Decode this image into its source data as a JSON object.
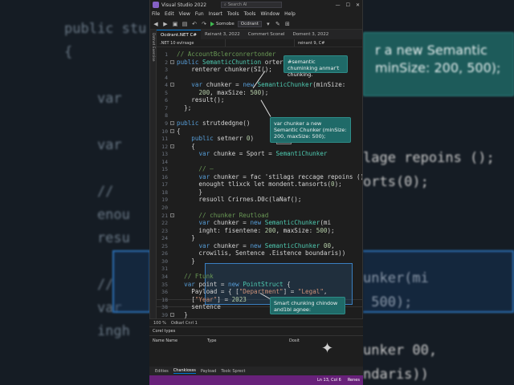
{
  "window": {
    "title": "Visual Studio 2022",
    "search_placeholder": "Search AI",
    "minimize": "—",
    "maximize": "☐",
    "close": "✕"
  },
  "menu": [
    "File",
    "Edit",
    "View",
    "Fun",
    "Insert",
    "Tools",
    "Tools",
    "Window",
    "Help"
  ],
  "toolbar": {
    "run_label": "Sornobe",
    "config": "Ocdrant"
  },
  "sidebar_label": "Dotnet Exercise",
  "tabs": [
    "Ocdrant.NET C#",
    "Reinant 3, 2022",
    "Commert Sconel",
    "Doment 3, 2022"
  ],
  "navbar": [
    ".NET 10 evlrsage",
    "",
    "reinant 9, C#"
  ],
  "callouts": {
    "c1": "#semantic chuminking anmar't chunking.",
    "c2": "var chunker a new Semantic Chunker (minSize: 200, maxSize: 500);",
    "c3": "Smart chunking chindow and1bl agnee:"
  },
  "code_lines": [
    {
      "n": "1",
      "t": "// AccountBclerconrertonder"
    },
    {
      "n": "2",
      "t": "public SemanticChuntion orters"
    },
    {
      "n": "3",
      "t": "    renterer chunker(SI();"
    },
    {
      "n": "4",
      "t": ""
    },
    {
      "n": "4",
      "t": "    var chunker = new SemanticChunker(minSize:"
    },
    {
      "n": "5",
      "t": "      200, maxSize: 500);"
    },
    {
      "n": "6",
      "t": "    result();"
    },
    {
      "n": "7",
      "t": "  };"
    },
    {
      "n": "8",
      "t": ""
    },
    {
      "n": "9",
      "t": "public strutdedgne()"
    },
    {
      "n": "10",
      "t": "{"
    },
    {
      "n": "11",
      "t": "    public setnerr 0)"
    },
    {
      "n": "12",
      "t": "    {"
    },
    {
      "n": "13",
      "t": "      var chunke = Sport = SemantiChunker"
    },
    {
      "n": "14",
      "t": ""
    },
    {
      "n": "15",
      "t": "      // —"
    },
    {
      "n": "16",
      "t": "      var chunker = fac 'stilags reccage repoins ();"
    },
    {
      "n": "17",
      "t": "      enought tlixck let mondent.tansorts(0);"
    },
    {
      "n": "18",
      "t": "      }"
    },
    {
      "n": "19",
      "t": "      resuoll Crirnes.D0c(laNaf();"
    },
    {
      "n": "20",
      "t": ""
    },
    {
      "n": "21",
      "t": "      // chunker Reutload"
    },
    {
      "n": "22",
      "t": "      var chunker = new SemanticChunker(mi"
    },
    {
      "n": "23",
      "t": "      inght: fisentene: 200, maxSize: 500);"
    },
    {
      "n": "24",
      "t": "    }"
    },
    {
      "n": "25",
      "t": "      var chunker = new SemanticChunker 00,"
    },
    {
      "n": "26",
      "t": "      crowilis, Sentence .Eistence boundaris))"
    },
    {
      "n": "30",
      "t": "    }"
    },
    {
      "n": "31",
      "t": ""
    },
    {
      "n": "34",
      "t": "  // Ftunk"
    },
    {
      "n": "35",
      "t": "  var point = new PointStruct {"
    },
    {
      "n": "36",
      "t": "    Payload = { [\"Department\"] = \"Legal\","
    },
    {
      "n": "18",
      "t": "    [\"Year\"] = 2023"
    },
    {
      "n": "38",
      "t": "    sentence"
    },
    {
      "n": "39",
      "t": "  }"
    }
  ],
  "statusline": {
    "zoom": "100 %",
    "info": "Odkarl Cnrl 1"
  },
  "bottom_panel": {
    "title": "Corel types",
    "columns": [
      "Name Name",
      "Type",
      "Dosit"
    ]
  },
  "bottom_tabs": [
    "Edities",
    "Chankiosss",
    "Payload",
    "Toolc Sprect"
  ],
  "status_bar": {
    "left": "",
    "pos": "Ln 13, Col 6",
    "branch": "Renes"
  },
  "background": {
    "code": [
      "public stu",
      "{",
      "",
      "    var",
      "",
      "    var",
      "",
      "    //",
      "    enou",
      "    resu",
      "",
      "    //",
      "    var",
      "    ingh"
    ],
    "right_callout": "r a new Semantic minSize: 200, 500);",
    "right_code": [
      "lage repoins ();",
      "orts(0);",
      "",
      "",
      "",
      "unker(mi",
      " 500);",
      "",
      "unker 00,",
      "ndaris))"
    ]
  }
}
